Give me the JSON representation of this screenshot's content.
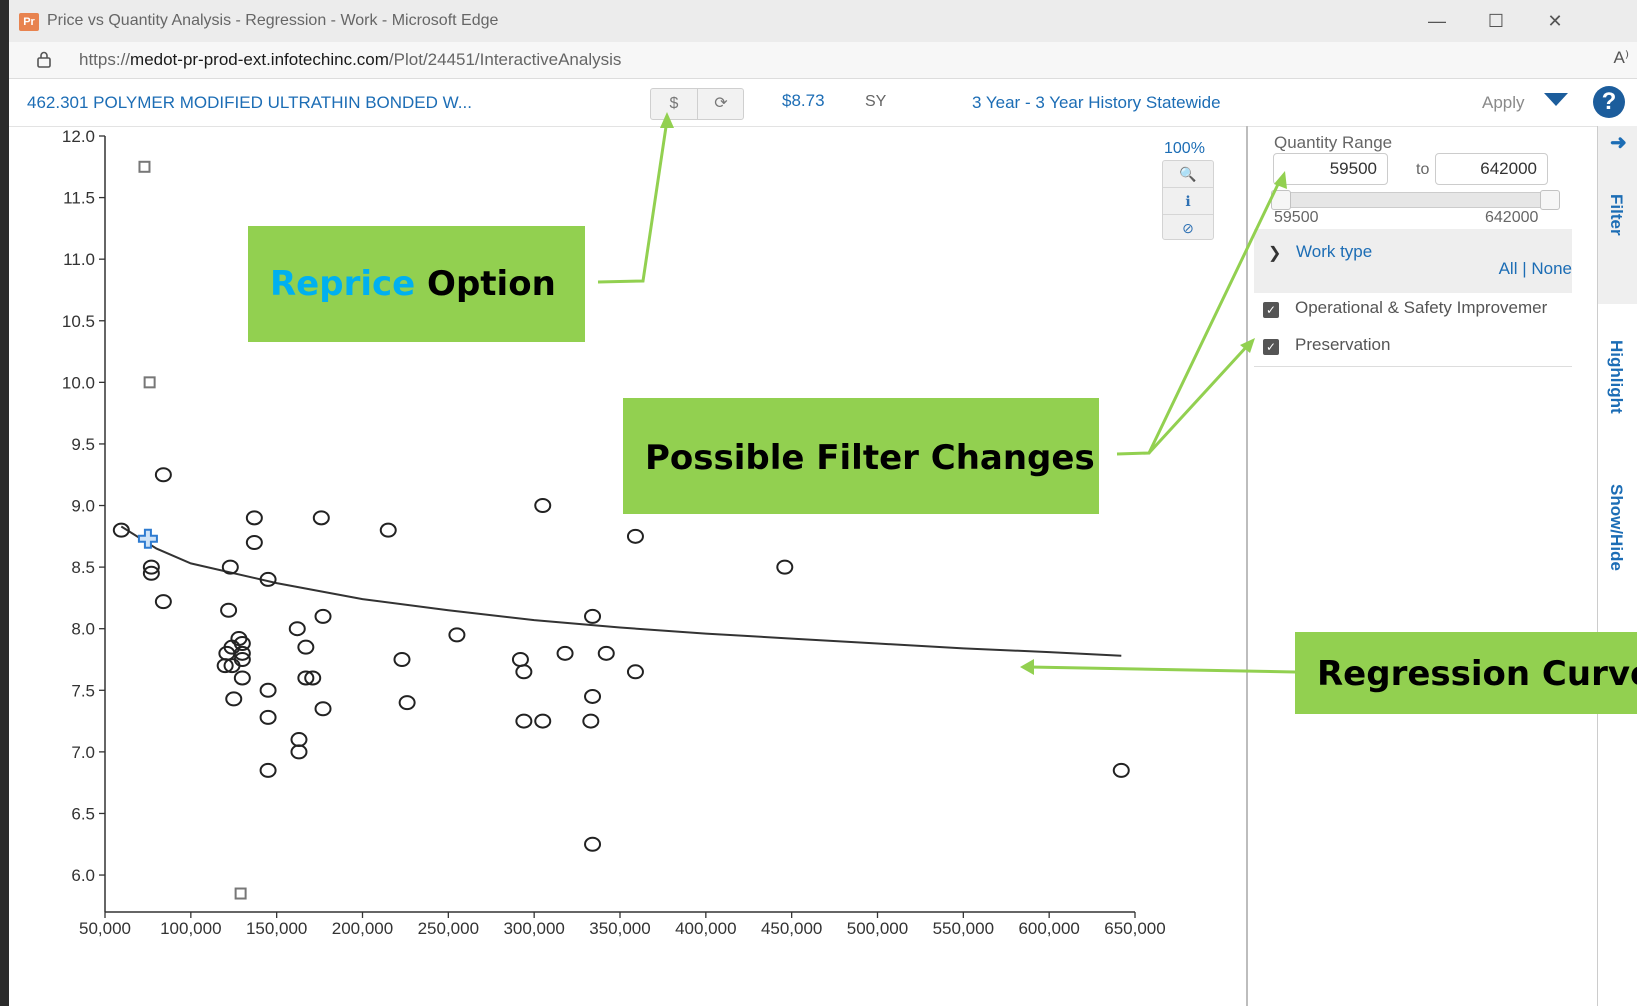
{
  "window": {
    "app_icon": "Pr",
    "title": "Price vs Quantity Analysis - Regression - Work - Microsoft Edge",
    "controls": {
      "minimize": "—",
      "maximize": "☐",
      "close": "✕"
    }
  },
  "address_bar": {
    "url_prefix": "https://",
    "url_domain": "medot-pr-prod-ext.infotechinc.com",
    "url_path": "/Plot/24451/InteractiveAnalysis",
    "read_aloud": "A⁾"
  },
  "toolbar": {
    "item_name": "462.301 POLYMER MODIFIED ULTRATHIN BONDED W...",
    "reprice_button": "$",
    "refresh_button": "⟳",
    "price": "$8.73",
    "unit": "SY",
    "history": "3 Year - 3 Year History Statewide",
    "apply": "Apply",
    "help": "?"
  },
  "zoom": {
    "level": "100%",
    "buttons": {
      "zoom": "🔍",
      "info": "ℹ",
      "reset": "⊘"
    }
  },
  "filter": {
    "quantity_range_label": "Quantity Range",
    "min_value": "59500",
    "max_value": "642000",
    "to_label": "to",
    "slider_min_label": "59500",
    "slider_max_label": "642000",
    "slider_fraction": [
      0.0,
      1.0
    ],
    "work_type_label": "Work type",
    "all_none": "All | None",
    "options": [
      {
        "label": "Operational & Safety Improvemer",
        "checked": true
      },
      {
        "label": "Preservation",
        "checked": true
      }
    ]
  },
  "side_tabs": {
    "arrow": "➜",
    "filter": "Filter",
    "highlight": "Highlight",
    "show_hide": "Show/Hide"
  },
  "callouts": {
    "reprice_word": "Reprice",
    "option_word": " Option",
    "filter_changes": "Possible Filter Changes",
    "regression_curve": "Regression Curve"
  },
  "colors": {
    "link_blue": "#1c6db5",
    "callout_green": "#92d050",
    "arrow_green": "#92d050",
    "reprice_blue": "#00b0f0"
  },
  "chart_data": {
    "type": "scatter",
    "xlim": [
      50000,
      650000
    ],
    "ylim": [
      5.7,
      12.0
    ],
    "x_ticks": [
      50000,
      100000,
      150000,
      200000,
      250000,
      300000,
      350000,
      400000,
      450000,
      500000,
      550000,
      600000,
      650000
    ],
    "x_tick_labels": [
      "50,000",
      "100,000",
      "150,000",
      "200,000",
      "250,000",
      "300,000",
      "350,000",
      "400,000",
      "450,000",
      "500,000",
      "550,000",
      "600,000",
      "650,000"
    ],
    "y_ticks": [
      6.0,
      6.5,
      7.0,
      7.5,
      8.0,
      8.5,
      9.0,
      9.5,
      10.0,
      10.5,
      11.0,
      11.5,
      12.0
    ],
    "y_tick_labels": [
      "6.0",
      "6.5",
      "7.0",
      "7.5",
      "8.0",
      "8.5",
      "9.0",
      "9.5",
      "10.0",
      "10.5",
      "11.0",
      "11.5",
      "12.0"
    ],
    "points": [
      [
        59500,
        8.8
      ],
      [
        77000,
        8.5
      ],
      [
        77000,
        8.45
      ],
      [
        84000,
        9.25
      ],
      [
        84000,
        8.22
      ],
      [
        122000,
        8.15
      ],
      [
        123000,
        8.5
      ],
      [
        125000,
        7.43
      ],
      [
        124000,
        7.85
      ],
      [
        121000,
        7.8
      ],
      [
        120000,
        7.7
      ],
      [
        124000,
        7.7
      ],
      [
        128000,
        7.92
      ],
      [
        130000,
        7.88
      ],
      [
        130000,
        7.8
      ],
      [
        130000,
        7.75
      ],
      [
        130000,
        7.6
      ],
      [
        137000,
        8.9
      ],
      [
        137000,
        8.7
      ],
      [
        145000,
        8.4
      ],
      [
        145000,
        7.5
      ],
      [
        145000,
        7.28
      ],
      [
        145000,
        6.85
      ],
      [
        162000,
        8.0
      ],
      [
        163000,
        7.1
      ],
      [
        163000,
        7.0
      ],
      [
        167000,
        7.85
      ],
      [
        167000,
        7.6
      ],
      [
        171000,
        7.6
      ],
      [
        176000,
        8.9
      ],
      [
        177000,
        8.1
      ],
      [
        177000,
        7.35
      ],
      [
        215000,
        8.8
      ],
      [
        223000,
        7.75
      ],
      [
        226000,
        7.4
      ],
      [
        255000,
        7.95
      ],
      [
        292000,
        7.75
      ],
      [
        294000,
        7.65
      ],
      [
        294000,
        7.25
      ],
      [
        305000,
        9.0
      ],
      [
        305000,
        7.25
      ],
      [
        318000,
        7.8
      ],
      [
        334000,
        8.1
      ],
      [
        334000,
        7.45
      ],
      [
        333000,
        7.25
      ],
      [
        334000,
        6.25
      ],
      [
        342000,
        7.8
      ],
      [
        359000,
        8.75
      ],
      [
        359000,
        7.65
      ],
      [
        446000,
        8.5
      ],
      [
        642000,
        6.85
      ]
    ],
    "outliers": [
      [
        73000,
        11.75
      ],
      [
        76000,
        10.0
      ],
      [
        129000,
        5.85
      ]
    ],
    "highlight_point": [
      75000,
      8.73
    ],
    "regression_curve": [
      [
        59500,
        8.83
      ],
      [
        80000,
        8.65
      ],
      [
        100000,
        8.53
      ],
      [
        150000,
        8.37
      ],
      [
        200000,
        8.24
      ],
      [
        250000,
        8.15
      ],
      [
        300000,
        8.07
      ],
      [
        350000,
        8.01
      ],
      [
        400000,
        7.96
      ],
      [
        450000,
        7.92
      ],
      [
        500000,
        7.88
      ],
      [
        550000,
        7.84
      ],
      [
        600000,
        7.81
      ],
      [
        642000,
        7.78
      ]
    ],
    "grid": false
  }
}
